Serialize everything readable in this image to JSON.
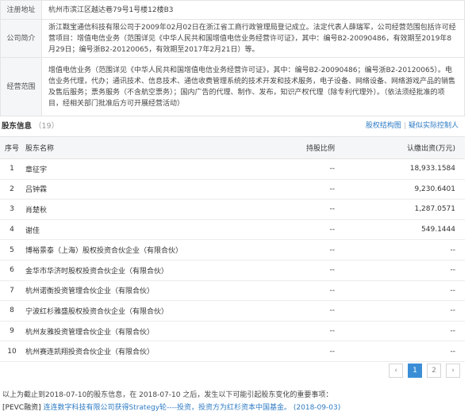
{
  "company_info": [
    {
      "label": "注册地址",
      "value": "杭州市滨江区越达巷79号1号楼12楼B3"
    },
    {
      "label": "公司简介",
      "value": "浙江戡宝通信科技有限公司于2009年02月02日在浙江省工商行政管理局登记成立。法定代表人薛瑞军，公司经营范围包括许可经营项目：增值电信业务（范围详见《中华人民共和国增值电信业务经营许可证》，其中：编号B2-20090486，有效期至2019年8月29日；编号浙B2-20120065，有效期至2017年2月21日）等。"
    },
    {
      "label": "经营范围",
      "value": "增值电信业务（范围详见《中华人民共和国增值电信业务经营许可证》，其中：编号B2-20090486；编号浙B2-20120065）。电信业务代理，代办；通讯技术、信息技术、通信收费管理系统的技术开发和技术服务，电子设备、网络设备、网络游戏产品的销售及售后服务；票务服务（不含航空票务）；国内广告的代理、制作、发布，知识产权代理（除专利代理外）。（依法须经批准的项目，经相关部门批准后方可开展经营活动）"
    }
  ],
  "shareholders": {
    "title": "股东信息",
    "count": "（19）",
    "link_structure": "股权结构图",
    "link_separator": "|",
    "link_controller": "疑似实际控制人",
    "columns": {
      "index": "序号",
      "name": "股东名称",
      "ratio": "持股比例",
      "amount": "认缴出资(万元)"
    },
    "rows": [
      {
        "index": "1",
        "name": "章征宇",
        "ratio": "--",
        "amount": "18,933.1584"
      },
      {
        "index": "2",
        "name": "吕钟霖",
        "ratio": "--",
        "amount": "9,230.6401"
      },
      {
        "index": "3",
        "name": "肖楚秋",
        "ratio": "--",
        "amount": "1,287.0571"
      },
      {
        "index": "4",
        "name": "谢佳",
        "ratio": "--",
        "amount": "549.1444"
      },
      {
        "index": "5",
        "name": "博裕景泰（上海）股权投资合伙企业（有限合伙）",
        "ratio": "--",
        "amount": "--"
      },
      {
        "index": "6",
        "name": "金华市华济时股权投资合伙企业（有限合伙）",
        "ratio": "--",
        "amount": "--"
      },
      {
        "index": "7",
        "name": "杭州诺衡投资管理合伙企业（有限合伙）",
        "ratio": "--",
        "amount": "--"
      },
      {
        "index": "8",
        "name": "宁波红杉雅盛股权投资合伙企业（有限合伙）",
        "ratio": "--",
        "amount": "--"
      },
      {
        "index": "9",
        "name": "杭州友雅投资管理合伙企业（有限合伙）",
        "ratio": "--",
        "amount": "--"
      },
      {
        "index": "10",
        "name": "杭州赛连凯翔投资合伙企业（有限合伙）",
        "ratio": "--",
        "amount": "--"
      }
    ]
  },
  "pagination": {
    "prev": "‹",
    "pages": [
      "1",
      "2"
    ],
    "next": "›",
    "current": "1"
  },
  "footer": {
    "note": "以上为截止到2018-07-10的股东信息，在 2018-07-10 之后，发生以下可能引起股东变化的重要事项：",
    "pevc_tag": "[PEVC融资]",
    "pevc_text": "连连数字科技有限公司获得Strategy轮----投资，投资方为红杉资本中国基金。",
    "pevc_date": "(2018-09-03)"
  },
  "colors": {
    "link": "#2e7bc4",
    "active_page": "#3b8ed6",
    "header_bg": "#f5f6f8"
  }
}
